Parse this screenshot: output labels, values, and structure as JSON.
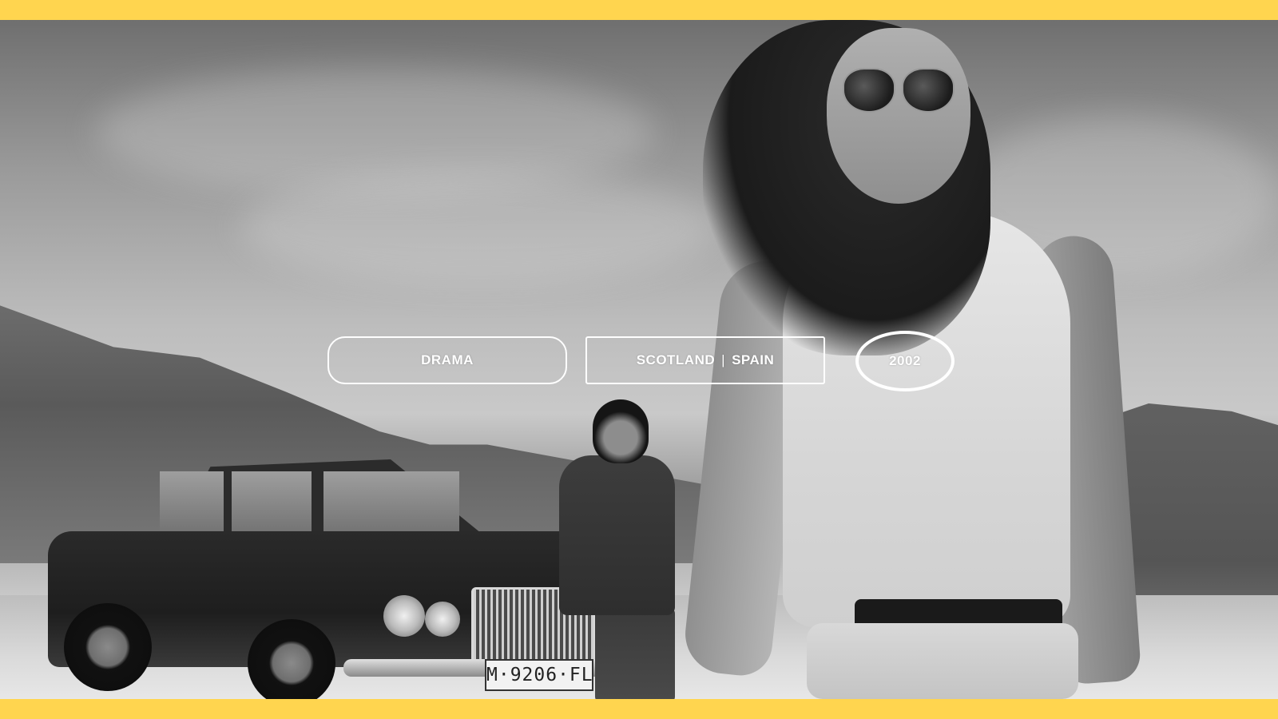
{
  "colors": {
    "frame": "#ffd54f",
    "tag_text": "#ffffff",
    "tag_border": "#ffffff"
  },
  "tags": {
    "genre": "DRAMA",
    "country_1": "SCOTLAND",
    "country_separator": "|",
    "country_2": "SPAIN",
    "year": "2002"
  },
  "photo": {
    "license_plate": "M·9206·FL"
  }
}
